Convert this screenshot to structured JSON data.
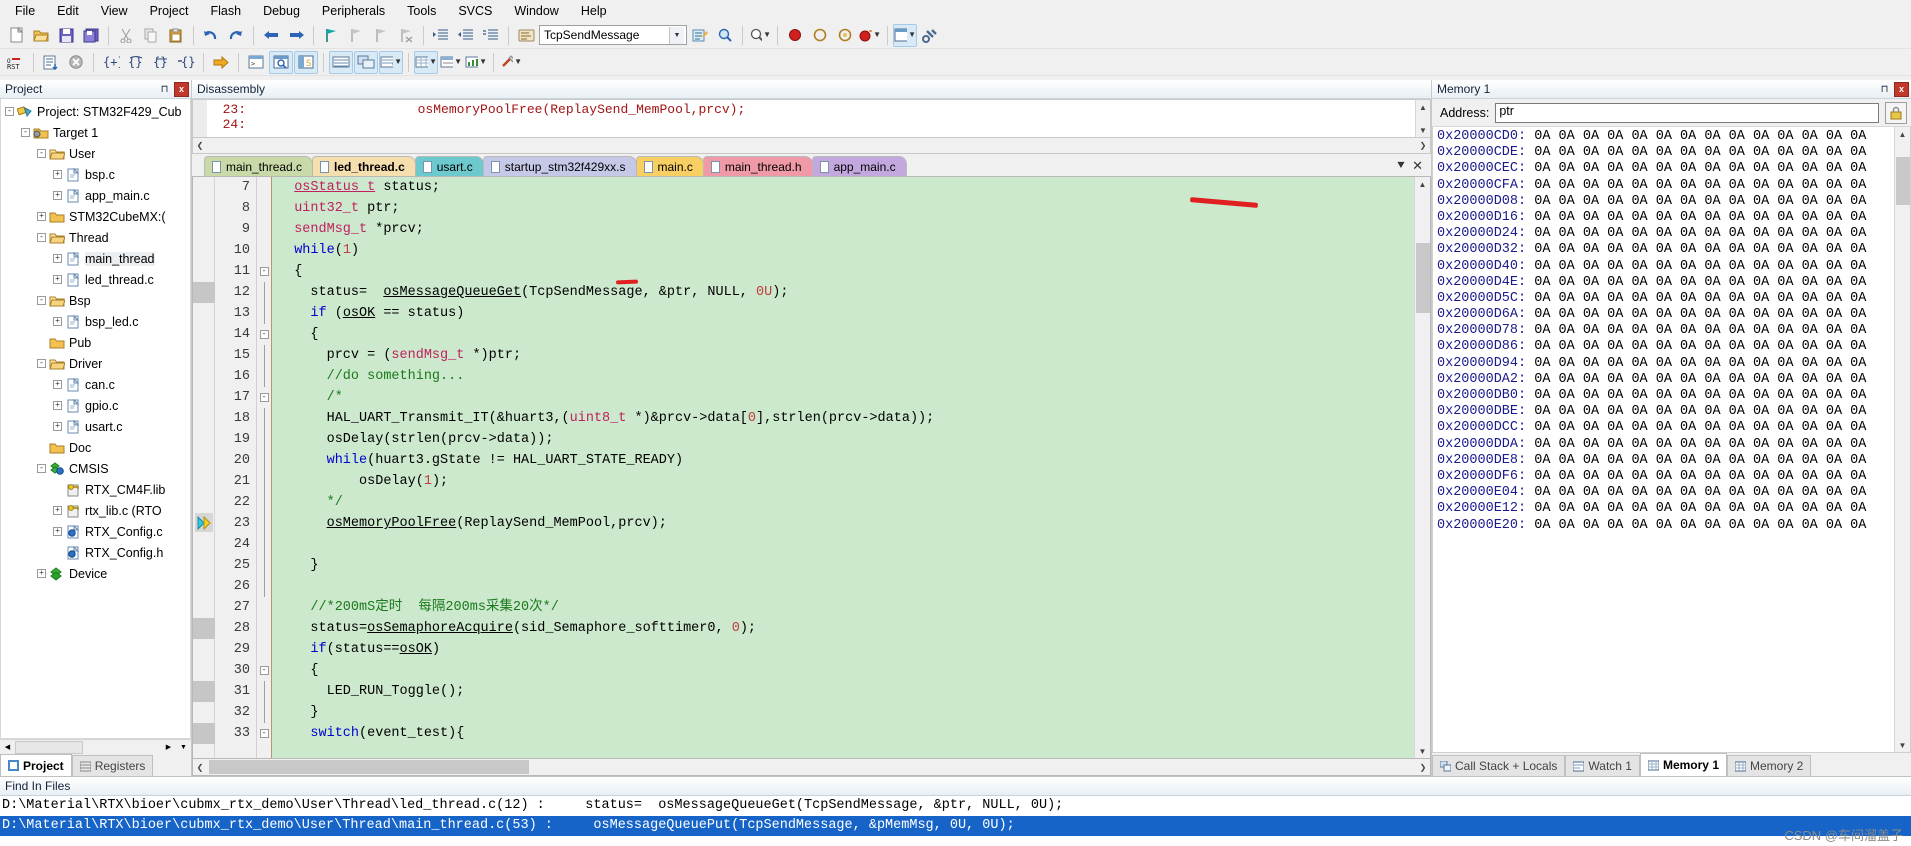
{
  "app": {
    "title": "Keil uVision - TcpSendMessage"
  },
  "menubar": {
    "items": [
      {
        "label": "File"
      },
      {
        "label": "Edit"
      },
      {
        "label": "View"
      },
      {
        "label": "Project"
      },
      {
        "label": "Flash"
      },
      {
        "label": "Debug"
      },
      {
        "label": "Peripherals"
      },
      {
        "label": "Tools"
      },
      {
        "label": "SVCS"
      },
      {
        "label": "Window"
      },
      {
        "label": "Help"
      }
    ]
  },
  "toolbar1": {
    "target_combo_value": "TcpSendMessage",
    "icons": [
      "new-file-icon",
      "open-folder-icon",
      "save-icon",
      "save-all-icon",
      "cut-icon",
      "copy-icon",
      "paste-icon",
      "undo-icon",
      "redo-icon",
      "navigate-back-icon",
      "navigate-forward-icon",
      "bookmark-toggle-icon",
      "bookmark-prev-icon",
      "bookmark-next-icon",
      "bookmark-clear-icon",
      "indent-icon",
      "outdent-icon",
      "comment-icon",
      "target-options-icon",
      "build-target-icon",
      "magnifier-icon",
      "insert-breakpoint-icon",
      "disable-breakpoint-icon",
      "disable-all-breakpoints-icon",
      "kill-all-breakpoints-icon",
      "manage-windows-icon",
      "configure-icon"
    ]
  },
  "toolbar2": {
    "icons": [
      "reset-cpu-icon",
      "run-to-main-icon",
      "stop-icon",
      "step-icon",
      "step-over-icon",
      "step-out-icon",
      "run-to-cursor-icon",
      "show-next-statement-icon",
      "command-window-icon",
      "disassembly-window-icon",
      "symbols-window-icon",
      "registers-window-icon",
      "call-stack-icon",
      "watch-window-icon",
      "memory-window-icon",
      "serial-window-icon",
      "analysis-window-icon",
      "trace-icon",
      "system-viewer-icon",
      "toolbox-icon"
    ]
  },
  "project_pane": {
    "caption": "Project",
    "pin_icon": "pin-icon",
    "close_icon": "close-icon",
    "tree": [
      {
        "depth": 0,
        "expander": "-",
        "icon": "project-icon",
        "label": "Project: STM32F429_Cub"
      },
      {
        "depth": 1,
        "expander": "-",
        "icon": "target-icon",
        "label": "Target 1"
      },
      {
        "depth": 2,
        "expander": "-",
        "icon": "folder-open-icon",
        "label": "User"
      },
      {
        "depth": 3,
        "expander": "+",
        "icon": "c-file-icon",
        "label": "bsp.c"
      },
      {
        "depth": 3,
        "expander": "+",
        "icon": "c-file-icon",
        "label": "app_main.c"
      },
      {
        "depth": 2,
        "expander": "+",
        "icon": "folder-icon",
        "label": "STM32CubeMX:("
      },
      {
        "depth": 2,
        "expander": "-",
        "icon": "folder-open-icon",
        "label": "Thread"
      },
      {
        "depth": 3,
        "expander": "+",
        "icon": "c-file-icon",
        "label": "main_thread",
        "selected": true
      },
      {
        "depth": 3,
        "expander": "+",
        "icon": "c-file-icon",
        "label": "led_thread.c"
      },
      {
        "depth": 2,
        "expander": "-",
        "icon": "folder-open-icon",
        "label": "Bsp"
      },
      {
        "depth": 3,
        "expander": "+",
        "icon": "c-file-icon",
        "label": "bsp_led.c"
      },
      {
        "depth": 2,
        "expander": "",
        "icon": "folder-icon",
        "label": "Pub"
      },
      {
        "depth": 2,
        "expander": "-",
        "icon": "folder-open-icon",
        "label": "Driver"
      },
      {
        "depth": 3,
        "expander": "+",
        "icon": "c-file-icon",
        "label": "can.c"
      },
      {
        "depth": 3,
        "expander": "+",
        "icon": "c-file-icon",
        "label": "gpio.c"
      },
      {
        "depth": 3,
        "expander": "+",
        "icon": "c-file-icon",
        "label": "usart.c"
      },
      {
        "depth": 2,
        "expander": "",
        "icon": "folder-icon",
        "label": "Doc"
      },
      {
        "depth": 2,
        "expander": "-",
        "icon": "cmsis-icon",
        "label": "CMSIS"
      },
      {
        "depth": 3,
        "expander": "",
        "icon": "lib-key-icon",
        "label": "RTX_CM4F.lib"
      },
      {
        "depth": 3,
        "expander": "+",
        "icon": "lib-key-icon",
        "label": "rtx_lib.c (RTO"
      },
      {
        "depth": 3,
        "expander": "+",
        "icon": "config-file-icon",
        "label": "RTX_Config.c"
      },
      {
        "depth": 3,
        "expander": "",
        "icon": "config-file-icon",
        "label": "RTX_Config.h"
      },
      {
        "depth": 2,
        "expander": "+",
        "icon": "device-icon",
        "label": "Device"
      }
    ],
    "bottom_tabs": [
      {
        "label": "Project",
        "icon": "project-tab-icon",
        "active": true
      },
      {
        "label": "Registers",
        "icon": "registers-tab-icon",
        "active": false
      }
    ]
  },
  "disassembly": {
    "caption": "Disassembly",
    "lines": [
      "  23:                      osMemoryPoolFree(ReplaySend_MemPool,prcv);",
      "  24:"
    ]
  },
  "editor": {
    "tabs": [
      {
        "label": "main_thread.c",
        "color": "#c9d9a8",
        "active": false
      },
      {
        "label": "led_thread.c",
        "color": "#f6dfae",
        "active": true
      },
      {
        "label": "usart.c",
        "color": "#6cc9cd",
        "active": false
      },
      {
        "label": "startup_stm32f429xx.s",
        "color": "#c6c8e8",
        "active": false
      },
      {
        "label": "main.c",
        "color": "#f7cf62",
        "active": false
      },
      {
        "label": "main_thread.h",
        "color": "#ef9aa6",
        "active": false
      },
      {
        "label": "app_main.c",
        "color": "#c3a8e0",
        "active": false
      }
    ],
    "tab_menu_icon": "tab-list-icon",
    "tab_close_icon": "close-icon",
    "first_line_number": 7,
    "breakpoint_rows": [
      12,
      23,
      28,
      31,
      33
    ],
    "current_line": 23,
    "lines": [
      {
        "n": 7,
        "fold": "",
        "text": "  osStatus_t status;"
      },
      {
        "n": 8,
        "fold": "",
        "text": "  uint32_t ptr;"
      },
      {
        "n": 9,
        "fold": "",
        "text": "  sendMsg_t *prcv;"
      },
      {
        "n": 10,
        "fold": "",
        "text": "  while(1)"
      },
      {
        "n": 11,
        "fold": "-",
        "text": "  {"
      },
      {
        "n": 12,
        "fold": "|",
        "text": "    status=  osMessageQueueGet(TcpSendMessage, &ptr, NULL, 0U);"
      },
      {
        "n": 13,
        "fold": "|",
        "text": "    if (osOK == status)"
      },
      {
        "n": 14,
        "fold": "-",
        "text": "    {"
      },
      {
        "n": 15,
        "fold": "|",
        "text": "      prcv = (sendMsg_t *)ptr;"
      },
      {
        "n": 16,
        "fold": "|",
        "text": "      //do something..."
      },
      {
        "n": 17,
        "fold": "-",
        "text": "      /*"
      },
      {
        "n": 18,
        "fold": "|",
        "text": "      HAL_UART_Transmit_IT(&huart3,(uint8_t *)&prcv->data[0],strlen(prcv->data));"
      },
      {
        "n": 19,
        "fold": "|",
        "text": "      osDelay(strlen(prcv->data));"
      },
      {
        "n": 20,
        "fold": "|",
        "text": "      while(huart3.gState != HAL_UART_STATE_READY)"
      },
      {
        "n": 21,
        "fold": "|",
        "text": "          osDelay(1);"
      },
      {
        "n": 22,
        "fold": "L",
        "text": "      */"
      },
      {
        "n": 23,
        "fold": "|",
        "text": "      osMemoryPoolFree(ReplaySend_MemPool,prcv);"
      },
      {
        "n": 24,
        "fold": "|",
        "text": ""
      },
      {
        "n": 25,
        "fold": "|",
        "text": "    }"
      },
      {
        "n": 26,
        "fold": "L",
        "text": ""
      },
      {
        "n": 27,
        "fold": "",
        "text": "    //*200mS定时  每隔200ms采集20次*/"
      },
      {
        "n": 28,
        "fold": "",
        "text": "    status=osSemaphoreAcquire(sid_Semaphore_softtimer0, 0);"
      },
      {
        "n": 29,
        "fold": "",
        "text": "    if(status==osOK)"
      },
      {
        "n": 30,
        "fold": "-",
        "text": "    {"
      },
      {
        "n": 31,
        "fold": "|",
        "text": "      LED_RUN_Toggle();"
      },
      {
        "n": 32,
        "fold": "L",
        "text": "    }"
      },
      {
        "n": 33,
        "fold": "-",
        "text": "    switch(event_test){"
      }
    ]
  },
  "memory_pane": {
    "caption": "Memory 1",
    "pin_icon": "pin-icon",
    "close_icon": "close-icon",
    "address_label": "Address:",
    "address_value": "ptr",
    "lock_icon": "lock-icon",
    "bytes_per_row": 14,
    "byte_value": "0A",
    "rows": [
      "0x20000CD0:",
      "0x20000CDE:",
      "0x20000CEC:",
      "0x20000CFA:",
      "0x20000D08:",
      "0x20000D16:",
      "0x20000D24:",
      "0x20000D32:",
      "0x20000D40:",
      "0x20000D4E:",
      "0x20000D5C:",
      "0x20000D6A:",
      "0x20000D78:",
      "0x20000D86:",
      "0x20000D94:",
      "0x20000DA2:",
      "0x20000DB0:",
      "0x20000DBE:",
      "0x20000DCC:",
      "0x20000DDA:",
      "0x20000DE8:",
      "0x20000DF6:",
      "0x20000E04:",
      "0x20000E12:",
      "0x20000E20:"
    ],
    "bottom_tabs": [
      {
        "label": "Call Stack + Locals",
        "icon": "call-stack-icon",
        "active": false
      },
      {
        "label": "Watch 1",
        "icon": "watch-icon",
        "active": false
      },
      {
        "label": "Memory 1",
        "icon": "memory-icon",
        "active": true
      },
      {
        "label": "Memory 2",
        "icon": "memory-icon",
        "active": false
      }
    ]
  },
  "find_in_files": {
    "caption": "Find In Files",
    "rows": [
      {
        "text": "D:\\Material\\RTX\\bioer\\cubmx_rtx_demo\\User\\Thread\\main_thread.c(53) :     osMessageQueuePut(TcpSendMessage, &pMemMsg, 0U, 0U);",
        "selected": true
      },
      {
        "text": "D:\\Material\\RTX\\bioer\\cubmx_rtx_demo\\User\\Thread\\led_thread.c(12) :     status=  osMessageQueueGet(TcpSendMessage, &ptr, NULL, 0U);",
        "selected": false
      }
    ],
    "watermark": "CSDN @车间溜盖子"
  },
  "colors": {
    "code_background": "#cce8cd",
    "selected_row": "#1664c8",
    "annotation_red": "#e02020",
    "keyword_blue": "#0000d0",
    "comment_green": "#1a7a1a",
    "string_red": "#c04040"
  }
}
